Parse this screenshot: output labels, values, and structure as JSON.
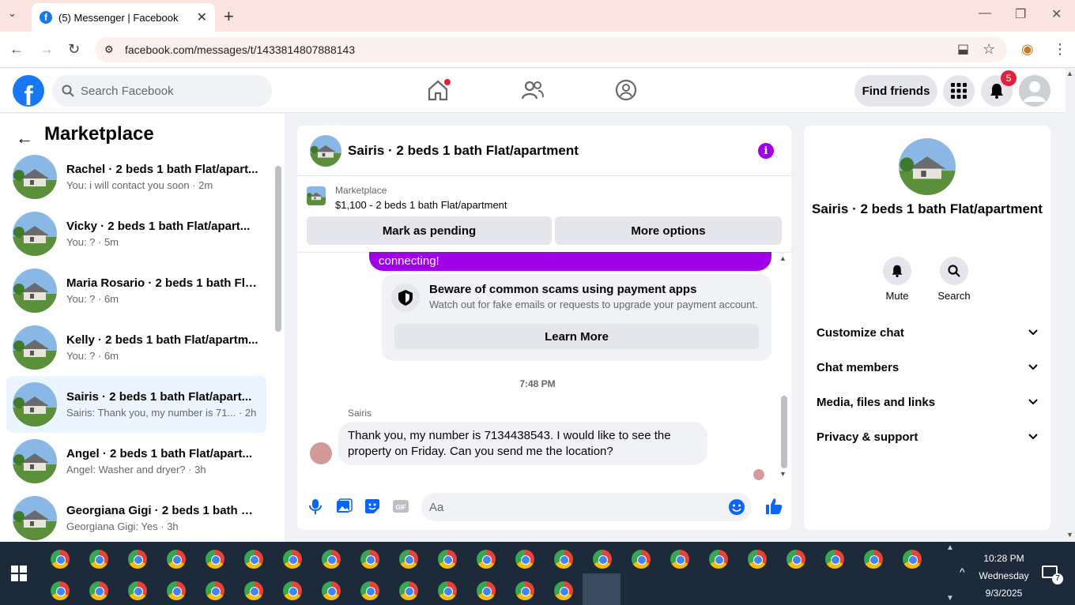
{
  "browser": {
    "tab_title": "(5) Messenger | Facebook",
    "url": "facebook.com/messages/t/1433814807888143"
  },
  "fb_header": {
    "search_placeholder": "Search Facebook",
    "find_friends": "Find friends",
    "notification_count": "5"
  },
  "sidebar": {
    "title": "Marketplace",
    "conversations": [
      {
        "name": "Rachel · 2 beds 1 bath Flat/apart...",
        "preview": "You: i will contact you soon · 2m",
        "selected": false
      },
      {
        "name": "Vicky · 2 beds 1 bath Flat/apart...",
        "preview": "You: ? · 5m",
        "selected": false
      },
      {
        "name": "Maria Rosario · 2 beds 1 bath Fla...",
        "preview": "You: ? · 6m",
        "selected": false
      },
      {
        "name": "Kelly · 2 beds 1 bath Flat/apartm...",
        "preview": "You: ? · 6m",
        "selected": false
      },
      {
        "name": "Sairis · 2 beds 1 bath Flat/apart...",
        "preview": "Sairis: Thank you, my number is 71... · 2h",
        "selected": true
      },
      {
        "name": "Angel · 2 beds 1 bath Flat/apart...",
        "preview": "Angel: Washer and dryer? · 3h",
        "selected": false
      },
      {
        "name": "Georgiana Gigi · 2 beds 1 bath Fl...",
        "preview": "Georgiana Gigi: Yes · 3h",
        "selected": false
      }
    ]
  },
  "chat": {
    "title": "Sairis · 2 beds 1 bath Flat/apartment",
    "marketplace_label": "Marketplace",
    "listing": "$1,100 - 2 beds 1 bath Flat/apartment",
    "mark_pending": "Mark as pending",
    "more_options": "More options",
    "purple_text": "connecting!",
    "scam_title": "Beware of common scams using payment apps",
    "scam_sub": "Watch out for fake emails or requests to upgrade your payment account.",
    "learn_more": "Learn More",
    "timestamp": "7:48 PM",
    "sender": "Sairis",
    "message": "Thank you, my number is 7134438543. I would like to see the property on Friday. Can you send me the location?",
    "composer_placeholder": "Aa"
  },
  "info_panel": {
    "name": "Sairis · 2 beds 1 bath Flat/apartment",
    "mute": "Mute",
    "search": "Search",
    "sections": [
      "Customize chat",
      "Chat members",
      "Media, files and links",
      "Privacy & support"
    ]
  },
  "taskbar": {
    "time": "10:28 PM",
    "day": "Wednesday",
    "date": "9/3/2025",
    "notif_count": "7"
  },
  "colors": {
    "fb_blue": "#1877f2",
    "messenger_purple": "#a000e8",
    "selected_bg": "#ebf5ff"
  }
}
